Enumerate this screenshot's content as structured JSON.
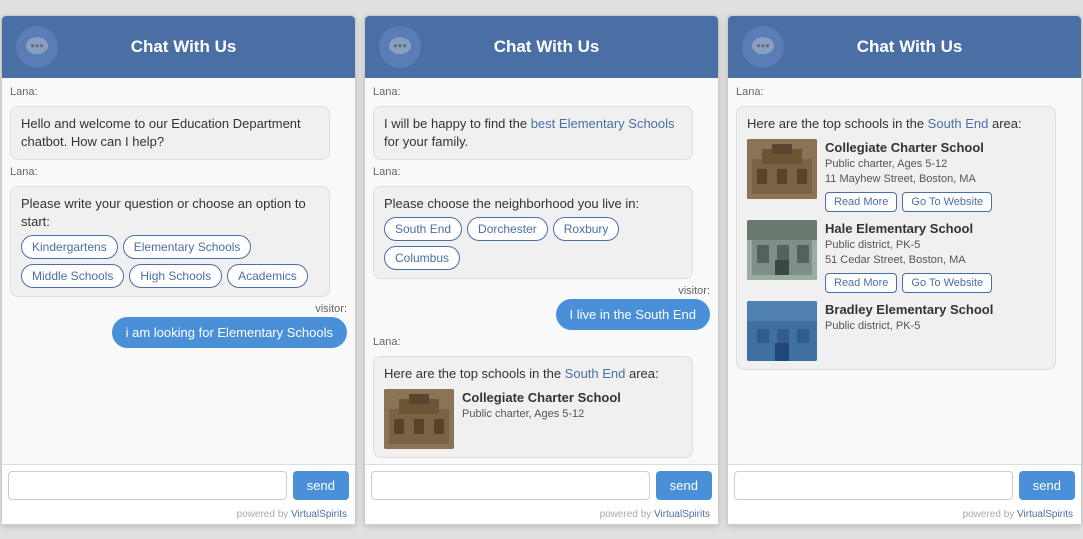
{
  "header": {
    "title": "Chat With Us"
  },
  "widgets": [
    {
      "id": "widget-1",
      "header_title": "Chat With Us",
      "messages": [
        {
          "type": "bot",
          "sender": "Lana:",
          "text": "Hello and welcome to our Education Department chatbot. How can I help?"
        },
        {
          "type": "bot",
          "sender": "Lana:",
          "text": "Please write your question or choose an option to start:",
          "options": [
            "Kindergartens",
            "Elementary Schools",
            "Middle Schools",
            "High Schools",
            "Academics"
          ]
        },
        {
          "type": "visitor",
          "sender": "visitor:",
          "text": "i am looking for Elementary Schools"
        }
      ],
      "input_placeholder": "",
      "send_label": "send",
      "powered_by": "powered by VirtualSpirits"
    },
    {
      "id": "widget-2",
      "header_title": "Chat With Us",
      "messages": [
        {
          "type": "bot",
          "sender": "Lana:",
          "text": "I will be happy to find the best Elementary Schools for your family.",
          "highlight_words": [
            "best",
            "Elementary",
            "Schools"
          ]
        },
        {
          "type": "bot",
          "sender": "Lana:",
          "text": "Please choose the neighborhood you live in:",
          "options": [
            "South End",
            "Dorchester",
            "Roxbury",
            "Columbus"
          ]
        },
        {
          "type": "visitor",
          "sender": "visitor:",
          "text": "I live in the South End"
        },
        {
          "type": "bot",
          "sender": "Lana:",
          "text": "Here are the top schools in the South End area:",
          "school_preview": {
            "name": "Collegiate Charter School",
            "type": "Public charter, Ages 5-12"
          }
        }
      ],
      "send_label": "send",
      "powered_by": "powered by VirtualSpirits"
    },
    {
      "id": "widget-3",
      "header_title": "Chat With Us",
      "messages": [
        {
          "type": "bot",
          "sender": "Lana:",
          "text": "Here are the top schools in the South End area:"
        },
        {
          "type": "school",
          "name": "Collegiate Charter School",
          "school_type": "Public charter, Ages 5-12",
          "address": "11 Mayhew Street, Boston, MA",
          "img_class": "school-img-collegiate",
          "buttons": [
            "Read More",
            "Go To Website"
          ]
        },
        {
          "type": "school",
          "name": "Hale Elementary School",
          "school_type": "Public district, PK-5",
          "address": "51 Cedar Street, Boston, MA",
          "img_class": "school-img-hale",
          "buttons": [
            "Read More",
            "Go To Website"
          ]
        },
        {
          "type": "school",
          "name": "Bradley Elementary School",
          "school_type": "Public district, PK-5",
          "address": "",
          "img_class": "school-img-bradley",
          "buttons": []
        }
      ],
      "send_label": "send",
      "powered_by": "powered by VirtualSpirits"
    }
  ]
}
